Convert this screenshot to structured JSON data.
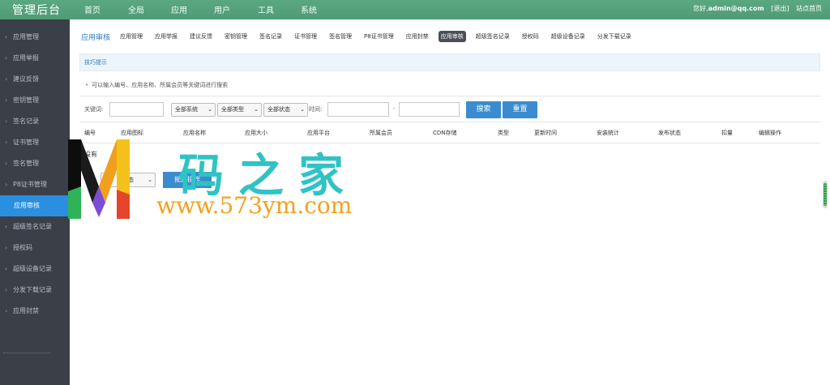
{
  "header": {
    "brand": "管理后台",
    "nav": [
      "首页",
      "全局",
      "应用",
      "用户",
      "工具",
      "系统"
    ],
    "greeting": "您好,",
    "user": "admin@qq.com",
    "logout": "[退出]",
    "site_home": "站点首页"
  },
  "sidebar": {
    "items": [
      {
        "label": "应用管理"
      },
      {
        "label": "应用举报"
      },
      {
        "label": "建议反馈"
      },
      {
        "label": "密钥管理"
      },
      {
        "label": "签名记录"
      },
      {
        "label": "证书管理"
      },
      {
        "label": "签名管理"
      },
      {
        "label": "P8证书管理"
      },
      {
        "label": "应用审核",
        "active": true
      },
      {
        "label": "超级签名记录"
      },
      {
        "label": "授权码"
      },
      {
        "label": "超级设备记录"
      },
      {
        "label": "分发下载记录"
      },
      {
        "label": "应用封禁"
      }
    ]
  },
  "main": {
    "section_title": "应用审核",
    "tabs": [
      "应用管理",
      "应用举报",
      "建议反馈",
      "密钥管理",
      "签名记录",
      "证书管理",
      "签名管理",
      "P8证书管理",
      "应用封禁",
      "应用审核",
      "超级签名记录",
      "授权码",
      "超级设备记录",
      "分发下载记录"
    ],
    "active_tab": "应用审核",
    "tip_title": "技巧提示",
    "tip_text": "可以输入编号、应用名称、所属会员等关键词进行搜索",
    "filters": {
      "keyword_label": "关键词:",
      "keyword_value": "",
      "system_select": "全部系统",
      "type_select": "全部类型",
      "status_select": "全部状态",
      "time_label": "时间:",
      "time_sep": "-",
      "search_btn": "搜索",
      "reset_btn": "重置"
    },
    "columns": [
      "编号",
      "应用图标",
      "应用名称",
      "应用大小",
      "应用平台",
      "所属会员",
      "CDN存储",
      "类型",
      "更新时间",
      "安装统计",
      "发布状态",
      "扣量",
      "编辑操作"
    ],
    "empty_text": "没有",
    "bulk_select": "状态",
    "bulk_btn": "批量操作"
  },
  "watermark": {
    "cn": "码之家",
    "url": "www.573ym.com"
  },
  "colors": {
    "topbar": "#52a27c",
    "sidebar": "#3b3f48",
    "active": "#2a8fe0",
    "button": "#3a8ccf",
    "watermark_cn": "#2fc3c4",
    "watermark_url": "#f1a21e"
  }
}
